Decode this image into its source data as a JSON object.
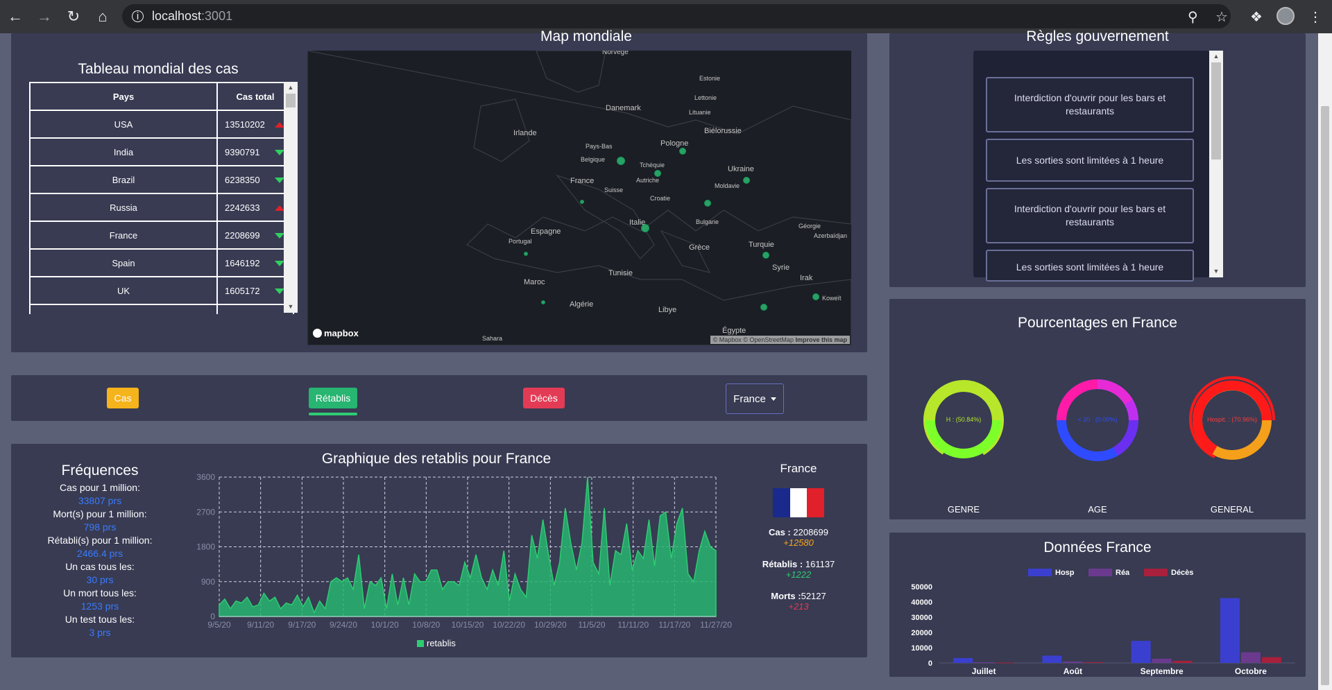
{
  "browser": {
    "url_host": "localhost",
    "url_port": ":3001"
  },
  "world_table": {
    "title": "Tableau mondial des cas",
    "headers": [
      "Pays",
      "Cas total"
    ],
    "rows": [
      {
        "country": "USA",
        "cases": "13510202",
        "trend": "up"
      },
      {
        "country": "India",
        "cases": "9390791",
        "trend": "down"
      },
      {
        "country": "Brazil",
        "cases": "6238350",
        "trend": "down"
      },
      {
        "country": "Russia",
        "cases": "2242633",
        "trend": "up"
      },
      {
        "country": "France",
        "cases": "2208699",
        "trend": "down"
      },
      {
        "country": "Spain",
        "cases": "1646192",
        "trend": "down"
      },
      {
        "country": "UK",
        "cases": "1605172",
        "trend": "down"
      }
    ]
  },
  "map": {
    "title": "Map mondiale",
    "logo": "mapbox",
    "attribution": "© Mapbox © OpenStreetMap",
    "improve": "Improve this map",
    "labels": {
      "norvege": "Norvege",
      "estonie": "Estonie",
      "lettonie": "Lettonie",
      "danemark": "Danemark",
      "lituanie": "Lituanie",
      "irlande": "Irlande",
      "bielorussie": "Biélorussie",
      "paysbas": "Pays-Bas",
      "pologne": "Pologne",
      "belgique": "Belgique",
      "tchequie": "Tchéquie",
      "ukraine": "Ukraine",
      "france": "France",
      "autriche": "Autriche",
      "suisse": "Suisse",
      "moldavie": "Moldavie",
      "croatie": "Croatie",
      "italie": "Italie",
      "bulgarie": "Bulgarie",
      "georgie": "Géorgie",
      "espagne": "Espagne",
      "azerbaidjan": "Azerbaïdjan",
      "portugal": "Portugal",
      "grece": "Grèce",
      "turquie": "Turquie",
      "syrie": "Syrie",
      "tunisie": "Tunisie",
      "irak": "Irak",
      "maroc": "Maroc",
      "koweit": "Koweït",
      "algerie": "Algérie",
      "libye": "Libye",
      "egypte": "Égypte",
      "sahara": "Sahara"
    }
  },
  "rules": {
    "title": "Règles gouvernement",
    "items": [
      "Interdiction d'ouvrir pour les bars et restaurants",
      "Les sorties sont limitées à 1 heure",
      "Interdiction d'ouvrir pour les bars et restaurants",
      "Les sorties sont limitées à 1 heure"
    ]
  },
  "controls": {
    "cas": "Cas",
    "retablis": "Rétablis",
    "deces": "Décès",
    "country_select": "France"
  },
  "frequencies": {
    "title": "Fréquences",
    "items": [
      {
        "label": "Cas pour 1 million:",
        "value": "33807 prs"
      },
      {
        "label": "Mort(s) pour 1 million:",
        "value": "798 prs"
      },
      {
        "label": "Rétabli(s) pour 1 million:",
        "value": "2466.4 prs"
      },
      {
        "label": "Un cas tous les:",
        "value": "30 prs"
      },
      {
        "label": "Un mort tous les:",
        "value": "1253 prs"
      },
      {
        "label": "Un test tous les:",
        "value": "3 prs"
      }
    ]
  },
  "chart_data": [
    {
      "type": "area",
      "title": "Graphique des retablis pour France",
      "xlabel": "",
      "ylabel": "",
      "ylim": [
        0,
        3600
      ],
      "yticks": [
        0,
        900,
        1800,
        2700,
        3600
      ],
      "x": [
        "9/5/20",
        "9/11/20",
        "9/17/20",
        "9/24/20",
        "10/1/20",
        "10/8/20",
        "10/15/20",
        "10/22/20",
        "10/29/20",
        "11/5/20",
        "11/11/20",
        "11/17/20",
        "11/27/20"
      ],
      "series": [
        {
          "name": "retablis",
          "color": "#2ecc71",
          "values": [
            300,
            450,
            200,
            400,
            350,
            500,
            250,
            300,
            600,
            400,
            500,
            200,
            350,
            300,
            550,
            250,
            500,
            100,
            400,
            200,
            900,
            1000,
            900,
            1000,
            700,
            1600,
            200,
            900,
            800,
            1000,
            200,
            1100,
            300,
            1000,
            300,
            1100,
            900,
            900,
            1200,
            1200,
            700,
            900,
            900,
            800,
            1400,
            1000,
            1600,
            1000,
            700,
            1200,
            800,
            1700,
            400,
            1100,
            700,
            500,
            2100,
            1500,
            2500,
            1600,
            800,
            1400,
            2800,
            1900,
            1200,
            1900,
            3750,
            1400,
            1100,
            2800,
            800,
            1700,
            1600,
            2400,
            1200,
            1700,
            1500,
            2500,
            1300,
            2600,
            2700,
            1500,
            2400,
            2800,
            1100,
            900,
            1700,
            2200,
            1800,
            1700
          ]
        }
      ],
      "legend": "bottom",
      "grid": true
    },
    {
      "type": "bar",
      "title": "Données France",
      "categories": [
        "Juillet",
        "Août",
        "Septembre",
        "Octobre"
      ],
      "ylim": [
        0,
        50000
      ],
      "yticks": [
        0,
        10000,
        20000,
        30000,
        40000,
        50000
      ],
      "series": [
        {
          "name": "Hosp",
          "color": "#3b3fcf",
          "values": [
            3200,
            4800,
            14500,
            42500
          ]
        },
        {
          "name": "Réa",
          "color": "#6b3a8f",
          "values": [
            500,
            900,
            2800,
            7000
          ]
        },
        {
          "name": "Décès",
          "color": "#a8203c",
          "values": [
            300,
            500,
            1400,
            3800
          ]
        }
      ],
      "legend": "top",
      "grid": false
    }
  ],
  "country_card": {
    "name": "France",
    "cas_label": "Cas :",
    "cas_value": "2208699",
    "cas_delta": "+12580",
    "retablis_label": "Rétablis :",
    "retablis_value": "161137",
    "retablis_delta": "+1222",
    "morts_label": "Morts :",
    "morts_value": "52127",
    "morts_delta": "+213"
  },
  "percentages": {
    "title": "Pourcentages en France",
    "genre": {
      "label": "GENRE",
      "center": "H : (50.84%)",
      "value": 0.5084
    },
    "age": {
      "label": "AGE",
      "center": "< 20 : (0.00%)"
    },
    "general": {
      "label": "GENERAL",
      "center": "Hospit. : (70.96%)",
      "value": 0.7096
    }
  },
  "colors": {
    "panel": "#383b52",
    "bg": "#5c6077",
    "green": "#2ecc71",
    "accent_blue": "#3a7bff"
  }
}
